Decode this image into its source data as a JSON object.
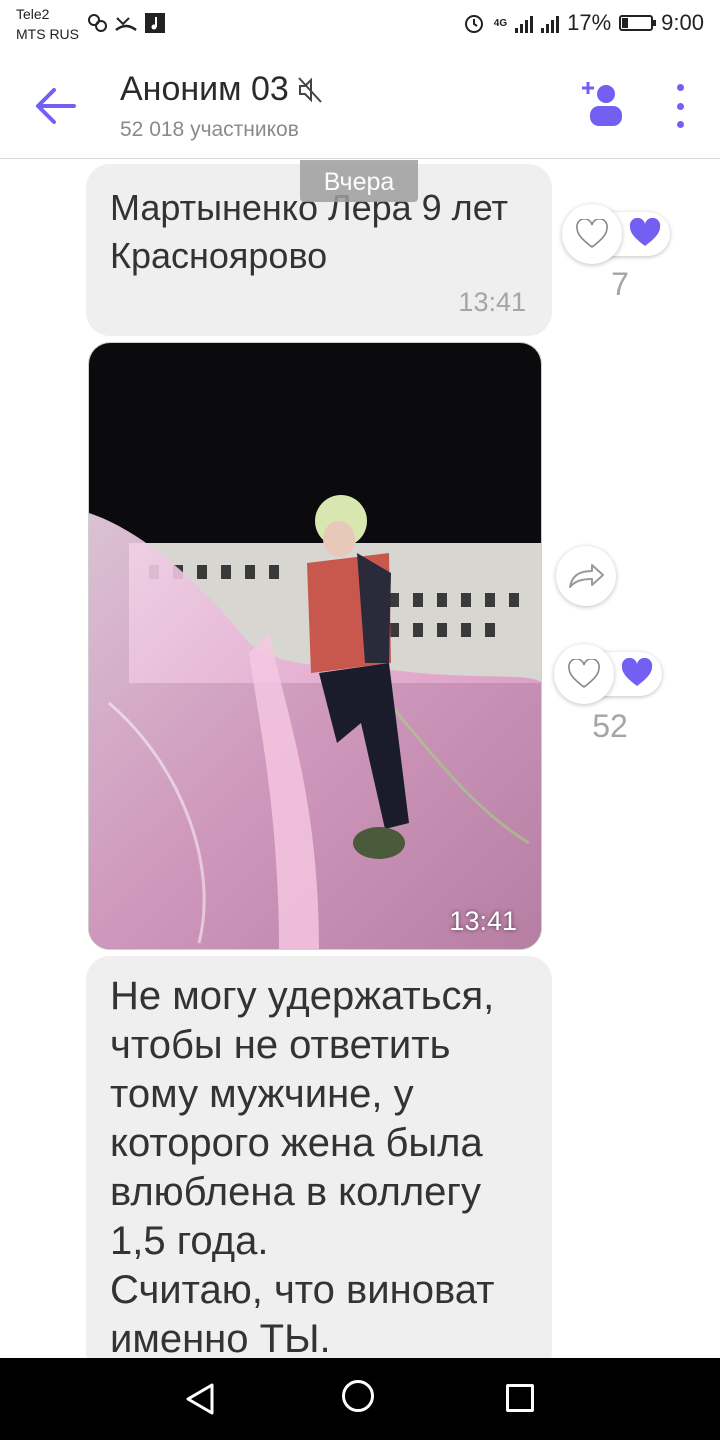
{
  "status_bar": {
    "carrier_1": "Tele2",
    "carrier_2": "MTS RUS",
    "network_label": "4G",
    "battery": "17%",
    "time": "9:00"
  },
  "header": {
    "title": "Аноним 03",
    "subtitle": "52 018 участников",
    "muted": true
  },
  "date_separator": "Вчера",
  "messages": [
    {
      "type": "text",
      "text": "Мартыненко Лера 9 лет Красноярово",
      "time": "13:41",
      "likes": "7"
    },
    {
      "type": "photo",
      "time": "13:41",
      "likes": "52"
    },
    {
      "type": "text",
      "text": "Не могу удержаться, чтобы не ответить тому мужчине, у которого жена была влюблена в коллегу 1,5 года.\nСчитаю, что виноват именно ТЫ."
    }
  ],
  "colors": {
    "accent": "#7360f2",
    "bubble": "#efefef",
    "muted_text": "#a5a5a5"
  },
  "icons": [
    "back-arrow-icon",
    "muted-icon",
    "add-member-icon",
    "more-icon",
    "heart-outline-icon",
    "heart-filled-icon",
    "share-icon",
    "nav-back-icon",
    "nav-home-icon",
    "nav-recent-icon"
  ]
}
